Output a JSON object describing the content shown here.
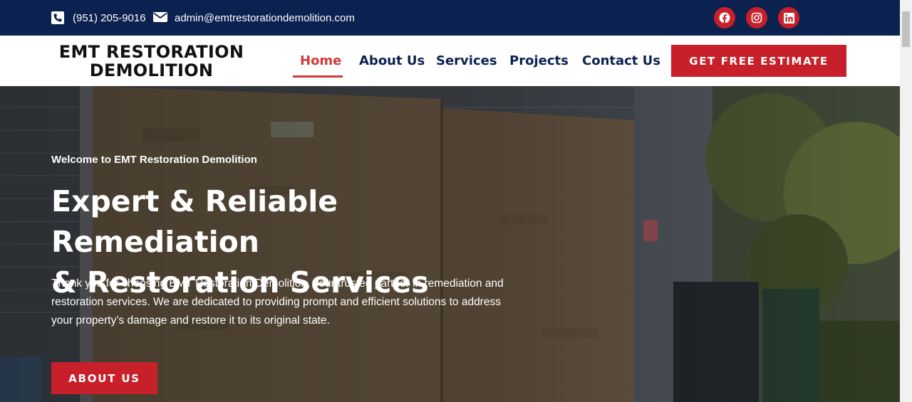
{
  "topbar": {
    "phone": "(951) 205-9016",
    "email": "admin@emtrestorationdemolition.com",
    "phone_icon": "phone-icon",
    "email_icon": "envelope-icon",
    "socials": [
      "facebook-icon",
      "instagram-icon",
      "linkedin-icon"
    ]
  },
  "header": {
    "logo_line1": "EMT RESTORATION",
    "logo_line2": "DEMOLITION",
    "nav": {
      "home": "Home",
      "about": "About Us",
      "services": "Services",
      "projects": "Projects",
      "contact": "Contact Us"
    },
    "cta": "GET FREE ESTIMATE"
  },
  "hero": {
    "eyebrow": "Welcome to EMT Restoration Demolition",
    "title_line1": "Expert & Reliable Remediation",
    "title_line2": "& Restoration Services",
    "description": "Thank you for choosing EMT Restoration Demolition, your trusted partner in remediation and restoration services. We are dedicated to providing prompt and efficient solutions to address your property’s damage and restore it to its original state.",
    "button": "ABOUT US"
  },
  "colors": {
    "navy": "#0b2150",
    "accent_red": "#c8202a",
    "active_link": "#d23a3a"
  }
}
